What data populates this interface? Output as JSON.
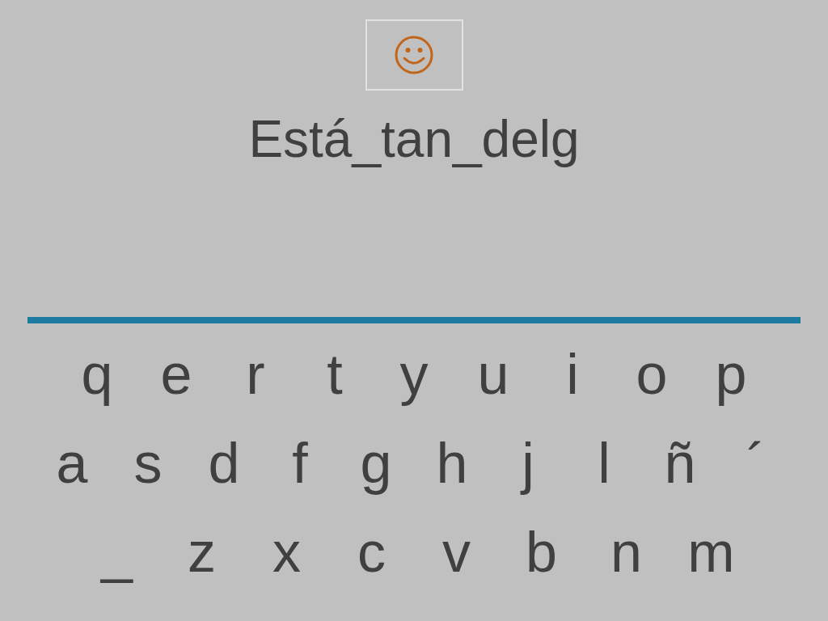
{
  "title": "Está_tan_delg",
  "keyboard": {
    "rows": [
      [
        "q",
        "e",
        "r",
        "t",
        "y",
        "u",
        "i",
        "o",
        "p"
      ],
      [
        "a",
        "s",
        "d",
        "f",
        "g",
        "h",
        "j",
        "l",
        "ñ",
        "´"
      ],
      [
        "_",
        "z",
        "x",
        "c",
        "v",
        "b",
        "n",
        "m"
      ]
    ]
  }
}
